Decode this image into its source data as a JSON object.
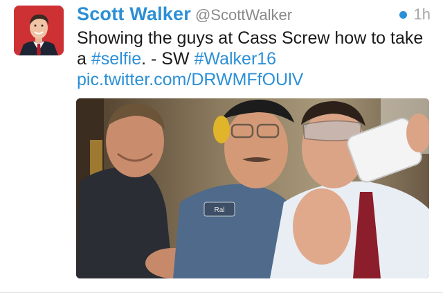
{
  "tweet": {
    "display_name": "Scott Walker",
    "handle": "@ScottWalker",
    "timestamp": "1h",
    "unread_dot_color": "#2b8fd6",
    "link_color": "#2b8fd6",
    "text_part1": "Showing the guys at Cass Screw how to take a ",
    "hashtag1": "#selfie",
    "text_part2": ". - SW ",
    "hashtag2": "#Walker16",
    "url": "pic.twitter.com/DRWMFfOUlV",
    "name_tag_text": "Ral"
  }
}
